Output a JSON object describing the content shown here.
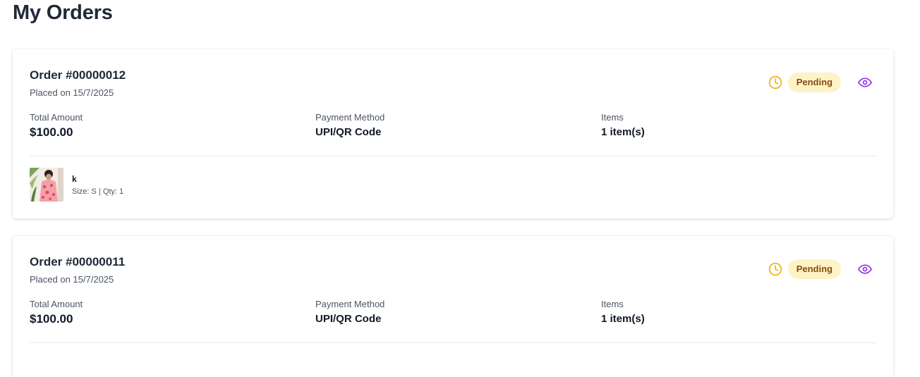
{
  "page": {
    "title": "My Orders"
  },
  "orders": [
    {
      "id_label": "Order #00000012",
      "placed_label": "Placed on 15/7/2025",
      "status": "Pending",
      "status_icon": "clock-icon",
      "view_icon": "eye-icon",
      "total_label": "Total Amount",
      "total_value": "$100.00",
      "payment_label": "Payment Method",
      "payment_value": "UPI/QR Code",
      "items_label": "Items",
      "items_value": "1 item(s)",
      "products": [
        {
          "name": "k",
          "meta": "Size: S | Qty: 1"
        }
      ]
    },
    {
      "id_label": "Order #00000011",
      "placed_label": "Placed on 15/7/2025",
      "status": "Pending",
      "status_icon": "clock-icon",
      "view_icon": "eye-icon",
      "total_label": "Total Amount",
      "total_value": "$100.00",
      "payment_label": "Payment Method",
      "payment_value": "UPI/QR Code",
      "items_label": "Items",
      "items_value": "1 item(s)"
    }
  ],
  "colors": {
    "status_pending_bg": "#fef3c7",
    "status_pending_text": "#854d0e",
    "clock_icon": "#eab308",
    "view_icon": "#9333ea"
  }
}
